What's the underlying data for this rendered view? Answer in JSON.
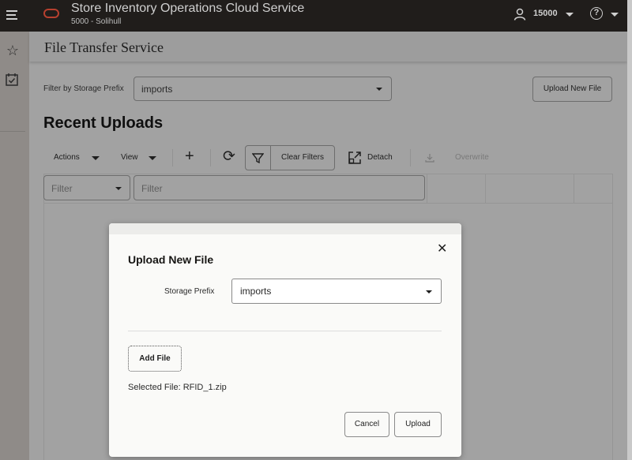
{
  "header": {
    "app_title": "Store Inventory Operations Cloud Service",
    "store": "5000 - Solihull",
    "user": "15000",
    "icons": [
      "hamburger-menu-icon",
      "oracle-logo",
      "user-icon",
      "help-icon"
    ]
  },
  "rail": {
    "items": [
      {
        "name": "favorites",
        "icon": "star-icon",
        "glyph": "☆"
      },
      {
        "name": "tasks",
        "icon": "calendar-check-icon",
        "glyph": "☑"
      }
    ]
  },
  "page": {
    "title": "File Transfer Service",
    "filter_label": "Filter by Storage Prefix",
    "filter_value": "imports",
    "upload_new_file_label": "Upload New File",
    "section_title": "Recent Uploads"
  },
  "toolbar": {
    "actions_label": "Actions",
    "view_label": "View",
    "add_glyph": "+",
    "refresh_glyph": "⟳",
    "clear_filters_label": "Clear Filters",
    "detach_label": "Detach",
    "overwrite_label": "Overwrite"
  },
  "grid": {
    "filter_select_placeholder": "Filter",
    "filter_input_placeholder": "Filter"
  },
  "dialog": {
    "title": "Upload New File",
    "close_glyph": "✕",
    "storage_prefix_label": "Storage Prefix",
    "storage_prefix_value": "imports",
    "add_file_label": "Add File",
    "selected_file": "Selected File: RFID_1.zip",
    "cancel_label": "Cancel",
    "upload_label": "Upload"
  },
  "colors": {
    "topbar": "#201d1b",
    "oracle_red": "#b7402f",
    "overlay": "#a2a2a2",
    "dialog_bg": "#fafaf8"
  }
}
